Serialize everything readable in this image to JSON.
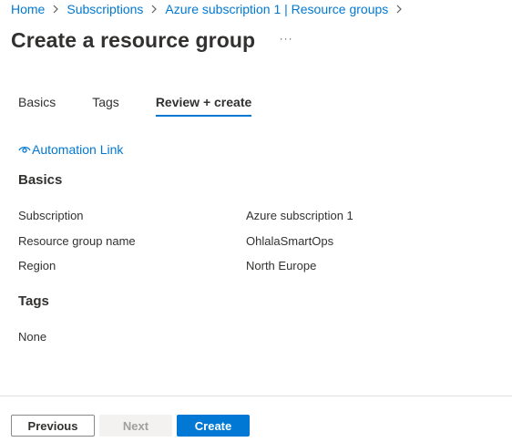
{
  "breadcrumb": {
    "items": [
      "Home",
      "Subscriptions",
      "Azure subscription 1 | Resource groups"
    ]
  },
  "header": {
    "title": "Create a resource group",
    "more_label": "···"
  },
  "tabs": [
    {
      "label": "Basics",
      "active": false
    },
    {
      "label": "Tags",
      "active": false
    },
    {
      "label": "Review + create",
      "active": true
    }
  ],
  "automation_link": {
    "label": "Automation Link",
    "icon": "eye-icon"
  },
  "basics": {
    "title": "Basics",
    "rows": [
      {
        "label": "Subscription",
        "value": "Azure subscription 1"
      },
      {
        "label": "Resource group name",
        "value": "OhlalaSmartOps"
      },
      {
        "label": "Region",
        "value": "North Europe"
      }
    ]
  },
  "tags": {
    "title": "Tags",
    "value": "None"
  },
  "footer": {
    "previous_label": "Previous",
    "next_label": "Next",
    "create_label": "Create"
  },
  "colors": {
    "accent": "#0078d4",
    "text": "#323130",
    "disabled_bg": "#f3f2f1",
    "disabled_text": "#a19f9d"
  }
}
